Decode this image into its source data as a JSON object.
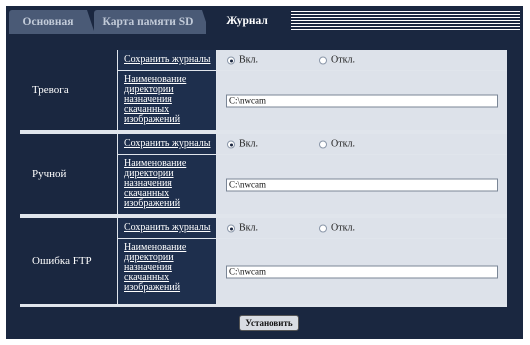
{
  "tabs": [
    {
      "label": "Основная",
      "active": false
    },
    {
      "label": "Карта памяти SD",
      "active": false
    },
    {
      "label": "Журнал",
      "active": true
    }
  ],
  "groups": [
    {
      "label": "Тревога",
      "save_log_label": "Сохранить журналы",
      "on_label": "Вкл.",
      "off_label": "Откл.",
      "selected": "on",
      "dir_label": "Наименование директории назначения скачанных изображений",
      "dir_value": "C:\\nwcam"
    },
    {
      "label": "Ручной",
      "save_log_label": "Сохранить журналы",
      "on_label": "Вкл.",
      "off_label": "Откл.",
      "selected": "on",
      "dir_label": "Наименование директории назначения скачанных изображений",
      "dir_value": "C:\\nwcam"
    },
    {
      "label": "Ошибка FTP",
      "save_log_label": "Сохранить журналы",
      "on_label": "Вкл.",
      "off_label": "Откл.",
      "selected": "on",
      "dir_label": "Наименование директории назначения скачанных изображений",
      "dir_value": "C:\\nwcam"
    }
  ],
  "set_button_label": "Установить",
  "colors": {
    "panel": "#1a2740",
    "tab_inactive": "#4a5a76",
    "row_bg": "#dde2ea"
  }
}
